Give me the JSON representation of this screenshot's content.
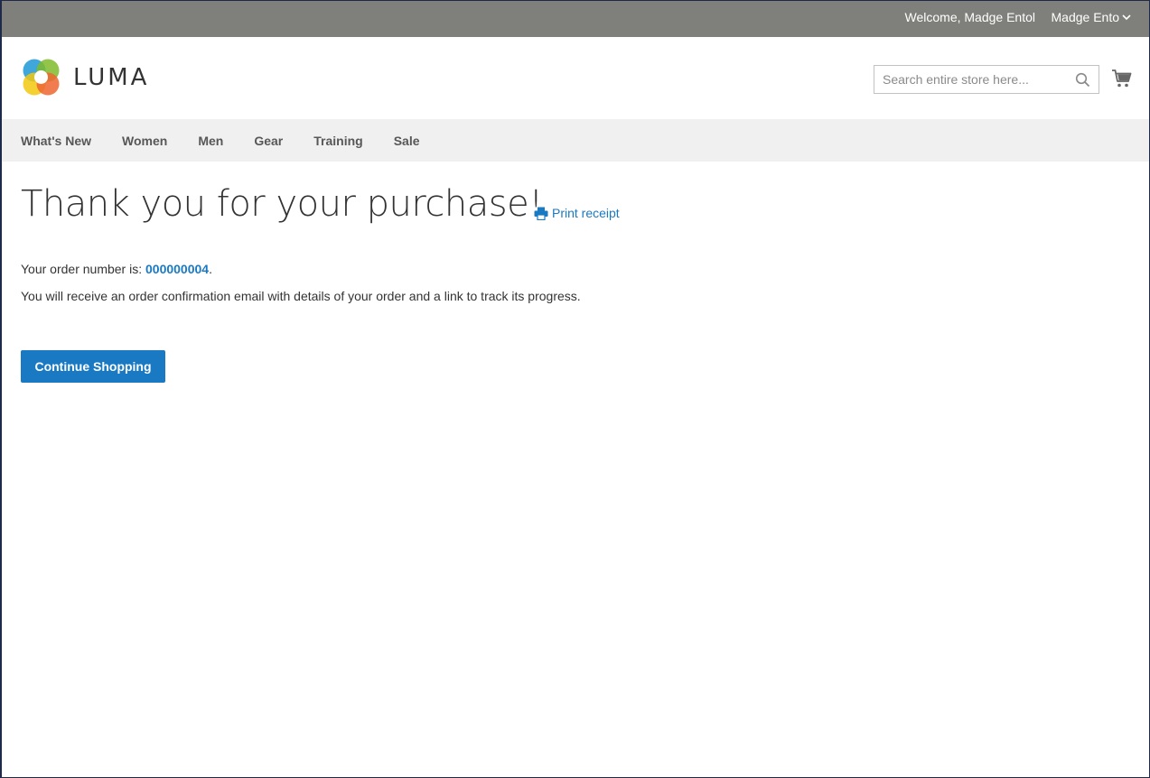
{
  "topbar": {
    "welcome": "Welcome, Madge Entol",
    "account_label": "Madge Ento"
  },
  "header": {
    "logo_text": "LUMA",
    "search_placeholder": "Search entire store here..."
  },
  "nav": {
    "items": [
      {
        "label": "What's New"
      },
      {
        "label": "Women"
      },
      {
        "label": "Men"
      },
      {
        "label": "Gear"
      },
      {
        "label": "Training"
      },
      {
        "label": "Sale"
      }
    ]
  },
  "main": {
    "title": "Thank you for your purchase!",
    "print_label": "Print receipt",
    "order_prefix": "Your order number is: ",
    "order_number": "000000004",
    "order_suffix": ".",
    "info_text": "You will receive an order confirmation email with details of your order and a link to track its progress.",
    "continue_label": "Continue Shopping"
  },
  "icons": {
    "account_toggle": "chevron-down-icon",
    "search": "search-icon",
    "cart": "cart-icon",
    "print": "print-icon",
    "logo": "luma-logo-icon"
  },
  "colors": {
    "topbar_bg": "#7f807b",
    "nav_bg": "#f0f0f0",
    "link": "#1979c3",
    "button_bg": "#1979c3"
  }
}
